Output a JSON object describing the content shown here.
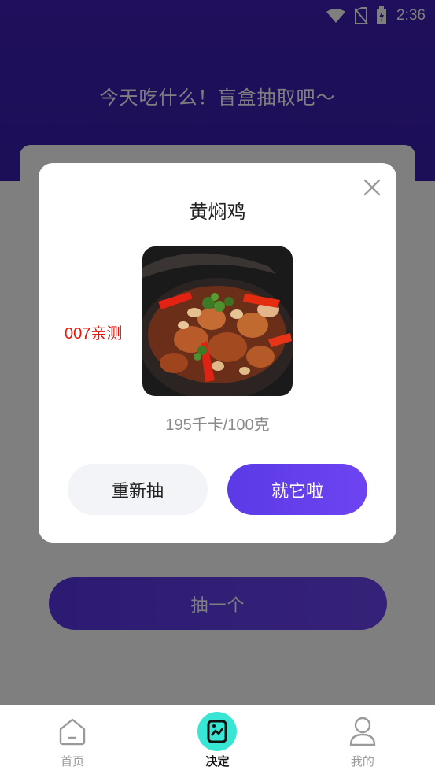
{
  "status_bar": {
    "time": "2:36",
    "icons": [
      "wifi-icon",
      "no-sim-icon",
      "battery-charging-icon"
    ]
  },
  "hero": {
    "title": "今天吃什么！盲盒抽取吧～",
    "background_color": "#3f1fb8"
  },
  "main": {
    "draw_button_label": "抽一个"
  },
  "modal": {
    "dish_name": "黄焖鸡",
    "watermark": "007亲测",
    "calories": "195千卡/100克",
    "redraw_label": "重新抽",
    "confirm_label": "就它啦",
    "accent_color": "#5b3ae6",
    "watermark_color": "#e8160c"
  },
  "bottom_nav": {
    "items": [
      {
        "label": "首页",
        "icon": "home-icon",
        "active": false
      },
      {
        "label": "决定",
        "icon": "image-icon",
        "active": true
      },
      {
        "label": "我的",
        "icon": "user-icon",
        "active": false
      }
    ],
    "active_color": "#37e6d3"
  }
}
